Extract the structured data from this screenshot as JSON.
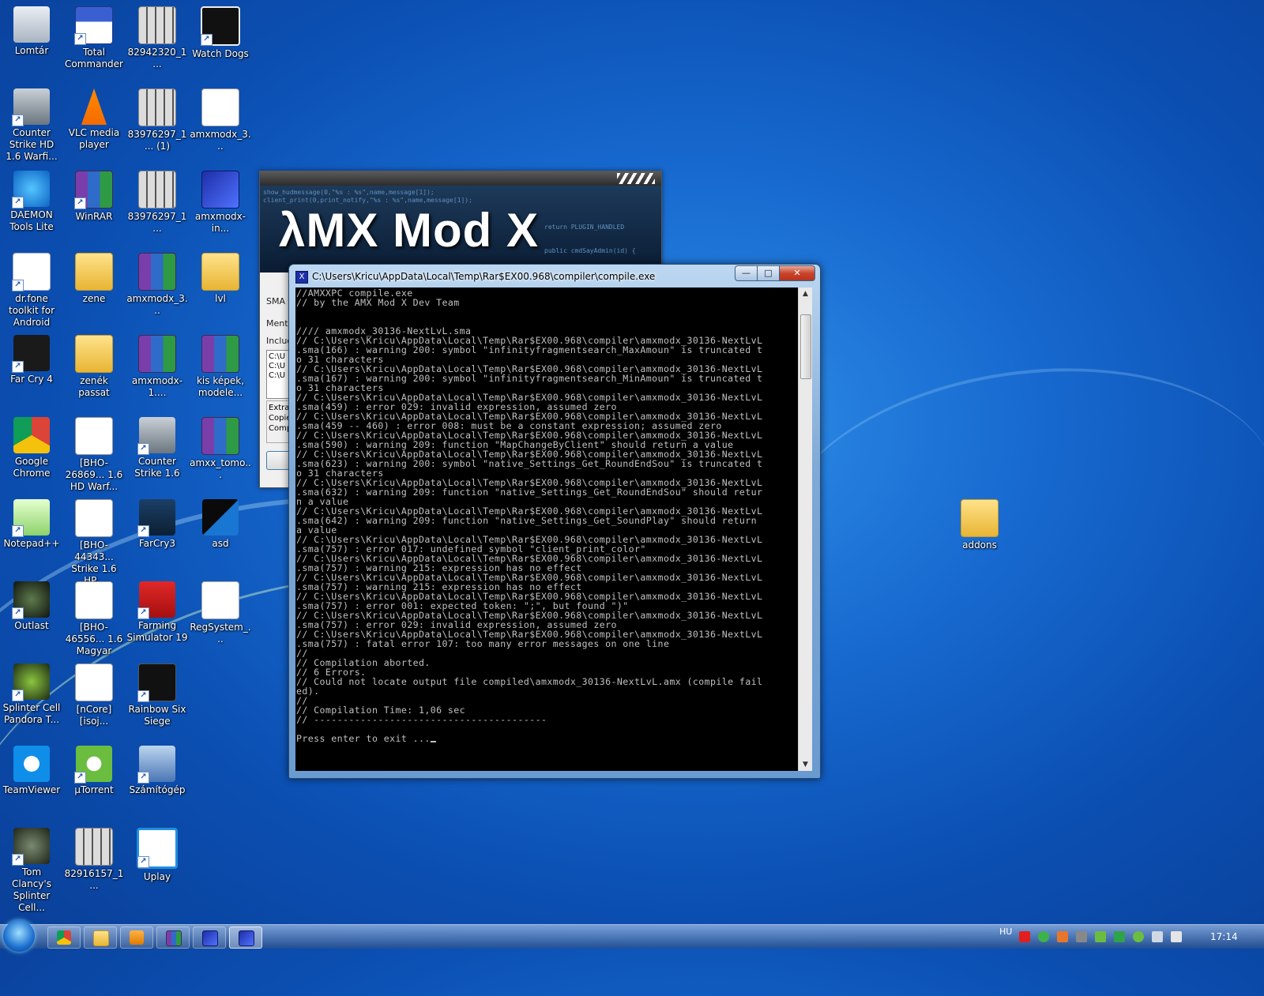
{
  "desktop": {
    "icons": [
      {
        "label": "Lomtár"
      },
      {
        "label": "Total Commander"
      },
      {
        "label": "82942320_1..."
      },
      {
        "label": "Watch Dogs"
      },
      {
        "label": "Counter Strike HD 1.6 Warfi..."
      },
      {
        "label": "VLC media player"
      },
      {
        "label": "83976297_1... (1)"
      },
      {
        "label": "amxmodx_3..."
      },
      {
        "label": "DAEMON Tools Lite"
      },
      {
        "label": "WinRAR"
      },
      {
        "label": "83976297_1..."
      },
      {
        "label": "amxmodx-in..."
      },
      {
        "label": "dr.fone toolkit for Android"
      },
      {
        "label": "zene"
      },
      {
        "label": "amxmodx_3..."
      },
      {
        "label": "lvl"
      },
      {
        "label": "Far Cry 4"
      },
      {
        "label": "zenék passat"
      },
      {
        "label": "amxmodx-1...."
      },
      {
        "label": "kis képek, modele..."
      },
      {
        "label": "Google Chrome"
      },
      {
        "label": "[BHO-26869... 1.6 HD Warf..."
      },
      {
        "label": "Counter Strike 1.6"
      },
      {
        "label": "amxx_tomo..."
      },
      {
        "label": "Notepad++"
      },
      {
        "label": "[BHO-44343... Strike 1.6 HP..."
      },
      {
        "label": "FarCry3"
      },
      {
        "label": "asd"
      },
      {
        "label": "Outlast"
      },
      {
        "label": "[BHO-46556... 1.6 Magyar"
      },
      {
        "label": "Farming Simulator 19"
      },
      {
        "label": "RegSystem_..."
      },
      {
        "label": "Splinter Cell Pandora T..."
      },
      {
        "label": "[nCore][isoj..."
      },
      {
        "label": "Rainbow Six Siege"
      },
      {
        "label": "TeamViewer"
      },
      {
        "label": "µTorrent"
      },
      {
        "label": "Számítógép"
      },
      {
        "label": "Tom Clancy's Splinter Cell..."
      },
      {
        "label": "82916157_1..."
      },
      {
        "label": "Uplay"
      },
      {
        "label": "addons"
      }
    ]
  },
  "amx_window": {
    "logo": "λMX Mod X",
    "banner_code_1": "show_hudmessage(0,\"%s : %s\",name,message[1]);",
    "banner_code_2": "client_print(0,print_notify,\"%s : %s\",name,message[1]);",
    "banner_code_3": "return PLUGIN_HANDLED",
    "banner_code_4": "public cmdSayAdmin(id) {",
    "label_sma": "SMA f",
    "label_mentes": "Menté",
    "label_include": "Includ",
    "list_items": [
      "C:\\U",
      "C:\\U",
      "C:\\U"
    ],
    "group_items": [
      "Extra",
      "Copie",
      "Comp"
    ]
  },
  "console": {
    "title": "C:\\Users\\Kricu\\AppData\\Local\\Temp\\Rar$EX00.968\\compiler\\compile.exe",
    "minimize": "—",
    "maximize": "□",
    "close": "✕",
    "output": "//AMXXPC compile.exe\n// by the AMX Mod X Dev Team\n\n\n//// amxmodx_30136-NextLvL.sma\n// C:\\Users\\Kricu\\AppData\\Local\\Temp\\Rar$EX00.968\\compiler\\amxmodx_30136-NextLvL\n.sma(166) : warning 200: symbol \"infinityfragmentsearch_MaxAmoun\" is truncated t\no 31 characters\n// C:\\Users\\Kricu\\AppData\\Local\\Temp\\Rar$EX00.968\\compiler\\amxmodx_30136-NextLvL\n.sma(167) : warning 200: symbol \"infinityfragmentsearch_MinAmoun\" is truncated t\no 31 characters\n// C:\\Users\\Kricu\\AppData\\Local\\Temp\\Rar$EX00.968\\compiler\\amxmodx_30136-NextLvL\n.sma(459) : error 029: invalid expression, assumed zero\n// C:\\Users\\Kricu\\AppData\\Local\\Temp\\Rar$EX00.968\\compiler\\amxmodx_30136-NextLvL\n.sma(459 -- 460) : error 008: must be a constant expression; assumed zero\n// C:\\Users\\Kricu\\AppData\\Local\\Temp\\Rar$EX00.968\\compiler\\amxmodx_30136-NextLvL\n.sma(590) : warning 209: function \"MapChangeByClient\" should return a value\n// C:\\Users\\Kricu\\AppData\\Local\\Temp\\Rar$EX00.968\\compiler\\amxmodx_30136-NextLvL\n.sma(623) : warning 200: symbol \"native_Settings_Get_RoundEndSou\" is truncated t\no 31 characters\n// C:\\Users\\Kricu\\AppData\\Local\\Temp\\Rar$EX00.968\\compiler\\amxmodx_30136-NextLvL\n.sma(632) : warning 209: function \"native_Settings_Get_RoundEndSou\" should retur\nn a value\n// C:\\Users\\Kricu\\AppData\\Local\\Temp\\Rar$EX00.968\\compiler\\amxmodx_30136-NextLvL\n.sma(642) : warning 209: function \"native_Settings_Get_SoundPlay\" should return\na value\n// C:\\Users\\Kricu\\AppData\\Local\\Temp\\Rar$EX00.968\\compiler\\amxmodx_30136-NextLvL\n.sma(757) : error 017: undefined symbol \"client_print_color\"\n// C:\\Users\\Kricu\\AppData\\Local\\Temp\\Rar$EX00.968\\compiler\\amxmodx_30136-NextLvL\n.sma(757) : warning 215: expression has no effect\n// C:\\Users\\Kricu\\AppData\\Local\\Temp\\Rar$EX00.968\\compiler\\amxmodx_30136-NextLvL\n.sma(757) : warning 215: expression has no effect\n// C:\\Users\\Kricu\\AppData\\Local\\Temp\\Rar$EX00.968\\compiler\\amxmodx_30136-NextLvL\n.sma(757) : error 001: expected token: \";\", but found \")\"\n// C:\\Users\\Kricu\\AppData\\Local\\Temp\\Rar$EX00.968\\compiler\\amxmodx_30136-NextLvL\n.sma(757) : error 029: invalid expression, assumed zero\n// C:\\Users\\Kricu\\AppData\\Local\\Temp\\Rar$EX00.968\\compiler\\amxmodx_30136-NextLvL\n.sma(757) : fatal error 107: too many error messages on one line\n//\n// Compilation aborted.\n// 6 Errors.\n// Could not locate output file compiled\\amxmodx_30136-NextLvL.amx (compile fail\ned).\n//\n// Compilation Time: 1,06 sec\n// ----------------------------------------\n\nPress enter to exit ...",
    "scroll_up": "▲",
    "scroll_down": "▼"
  },
  "taskbar": {
    "language": "HU",
    "clock": "17:14"
  },
  "colors": {
    "console_bg": "#000000",
    "console_text": "#c0c0c0",
    "wallpaper": "#1769cf"
  }
}
